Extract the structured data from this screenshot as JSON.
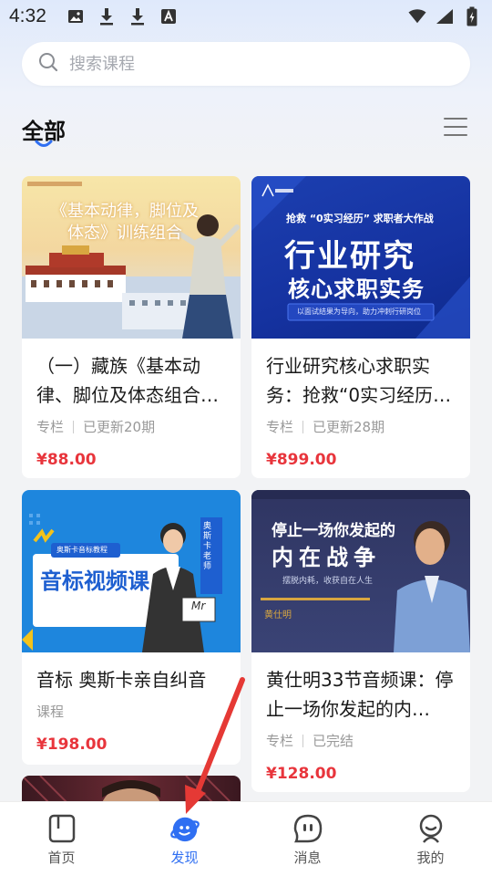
{
  "status_bar": {
    "time": "4:32",
    "icons_left": [
      "image-icon",
      "download-icon",
      "download-icon",
      "font-icon"
    ],
    "icons_right": [
      "wifi-icon",
      "signal-icon",
      "battery-icon"
    ]
  },
  "search": {
    "placeholder": "搜索课程"
  },
  "category": {
    "title": "全部",
    "accent_color": "#2f6ff2"
  },
  "courses": [
    {
      "title": "（一）藏族《基本动律、脚位及体态组合…",
      "type": "专栏",
      "update": "已更新20期",
      "price": "¥88.00",
      "thumb_lines": [
        "《基本动律，脚位及",
        "体态》训练组合"
      ]
    },
    {
      "title": "行业研究核心求职实务：抢救“0实习经历…",
      "type": "专栏",
      "update": "已更新28期",
      "price": "¥899.00",
      "thumb_lines": [
        "抢救 “0实习经历” 求职者大作战",
        "行业研究",
        "核心求职实务",
        "以面试结果为导向，助力冲刺行研岗位"
      ]
    },
    {
      "title": "音标 奥斯卡亲自纠音",
      "type": "课程",
      "price": "¥198.00",
      "thumb_lines": [
        "奥斯卡音标教程",
        "音标视频课",
        "奥斯卡老师",
        "Mr"
      ]
    },
    {
      "title": "黄仕明33节音频课：停止一场你发起的内…",
      "type": "专栏",
      "update": "已完结",
      "price": "¥128.00",
      "thumb_lines": [
        "停止一场你发起的",
        "内在战争",
        "摆脱内耗，收获自在人生",
        "黄仕明"
      ]
    }
  ],
  "tab_bar": {
    "tabs": [
      {
        "label": "首页",
        "icon": "home-icon"
      },
      {
        "label": "发现",
        "icon": "discover-icon"
      },
      {
        "label": "消息",
        "icon": "message-icon"
      },
      {
        "label": "我的",
        "icon": "profile-icon"
      }
    ],
    "active_index": 1,
    "active_color": "#2f6ff2"
  },
  "price_color": "#e8353c"
}
